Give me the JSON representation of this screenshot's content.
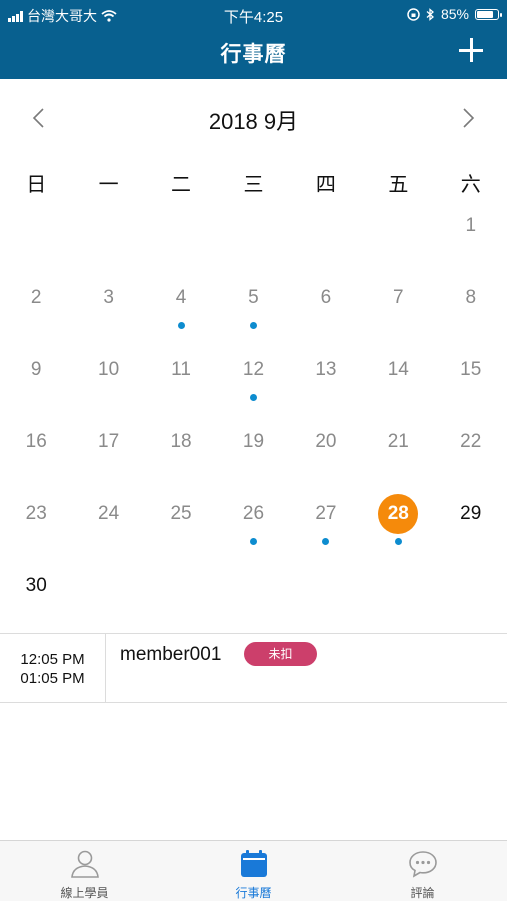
{
  "status_bar": {
    "carrier": "台灣大哥大",
    "time": "下午4:25",
    "battery_text": "85%",
    "battery_level": 0.85
  },
  "nav": {
    "title": "行事曆",
    "add_icon": "plus-icon"
  },
  "calendar": {
    "month_label": "2018 9月",
    "weekdays": [
      "日",
      "一",
      "二",
      "三",
      "四",
      "五",
      "六"
    ],
    "weeks": [
      [
        null,
        null,
        null,
        null,
        null,
        null,
        "1"
      ],
      [
        "2",
        "3",
        "4",
        "5",
        "6",
        "7",
        "8"
      ],
      [
        "9",
        "10",
        "11",
        "12",
        "13",
        "14",
        "15"
      ],
      [
        "16",
        "17",
        "18",
        "19",
        "20",
        "21",
        "22"
      ],
      [
        "23",
        "24",
        "25",
        "26",
        "27",
        "28",
        "29"
      ],
      [
        "30",
        null,
        null,
        null,
        null,
        null,
        null
      ]
    ],
    "event_days": [
      "4",
      "5",
      "12",
      "26",
      "27",
      "28"
    ],
    "today": "28",
    "future_days": [
      "29",
      "30"
    ],
    "colors": {
      "today": "#f58a0b",
      "event_dot": "#0d8ccf"
    }
  },
  "events": [
    {
      "start": "12:05 PM",
      "end": "01:05 PM",
      "name": "member001",
      "status": "未扣"
    }
  ],
  "tabs": [
    {
      "label": "線上學員",
      "icon": "person-icon",
      "active": false
    },
    {
      "label": "行事曆",
      "icon": "calendar-icon",
      "active": true
    },
    {
      "label": "評論",
      "icon": "chat-bubble-icon",
      "active": false
    }
  ],
  "colors": {
    "header": "#08608f",
    "badge": "#cc3f6b",
    "tab_active": "#1979d8"
  }
}
